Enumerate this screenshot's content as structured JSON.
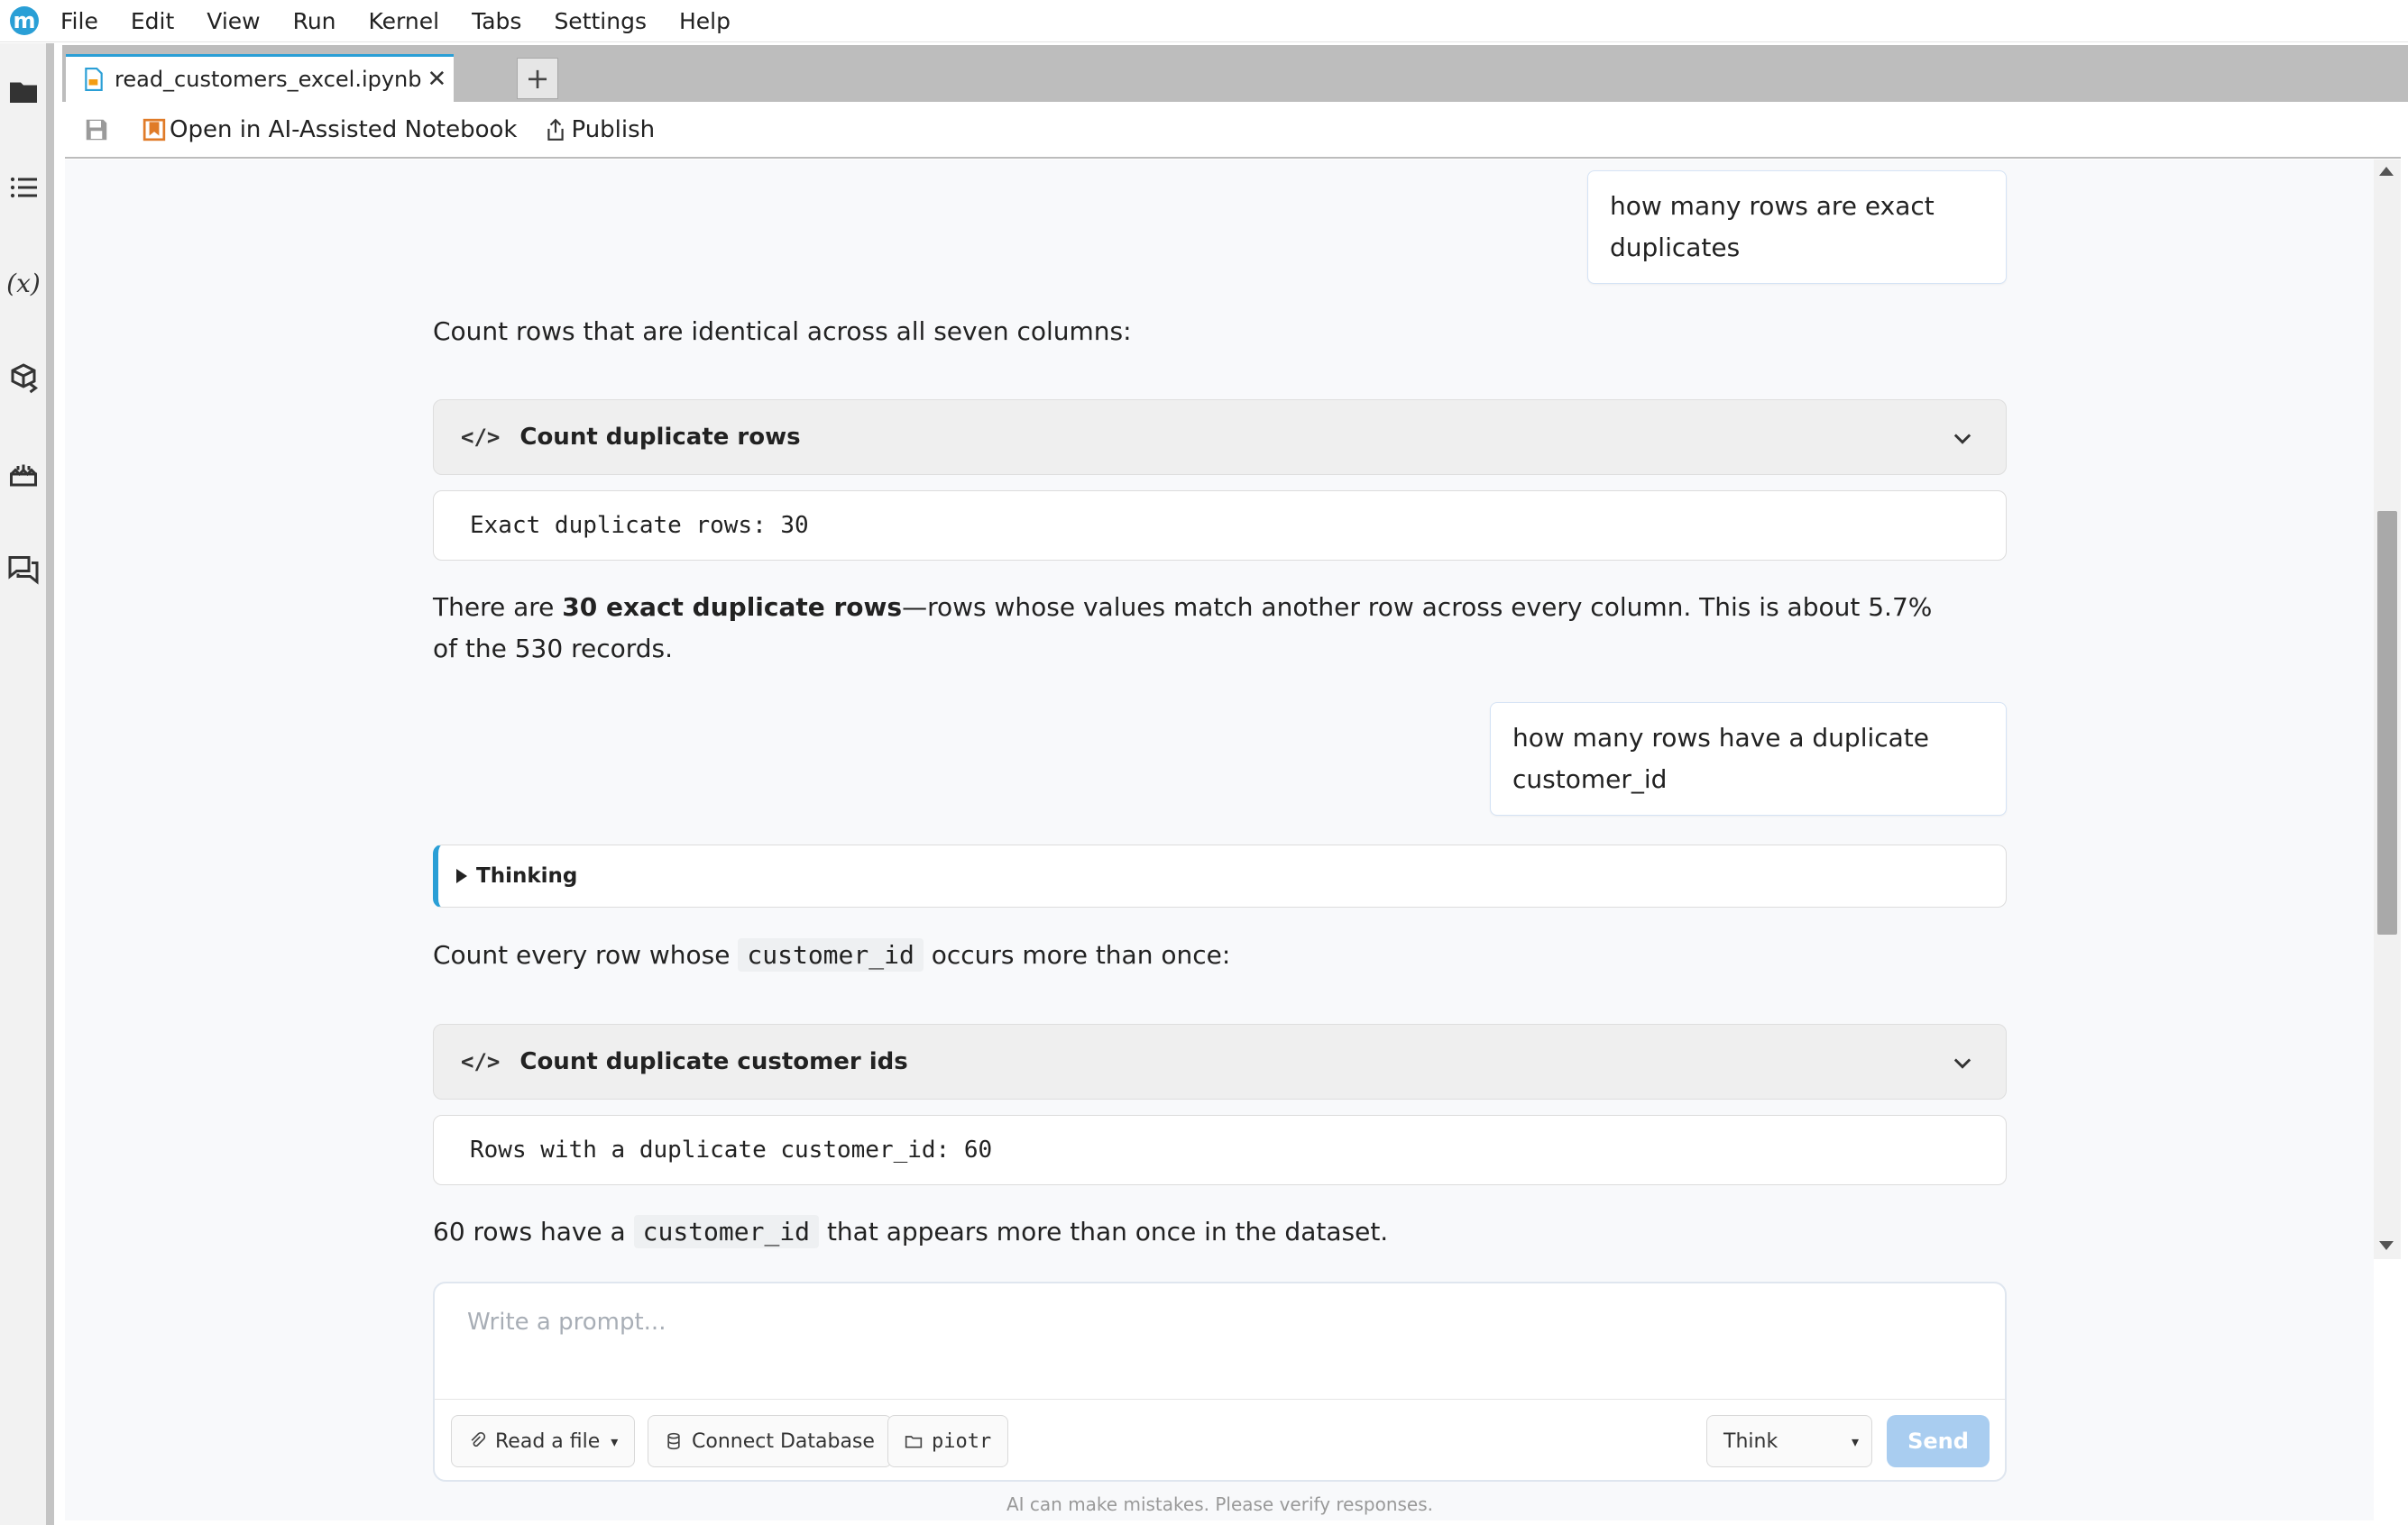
{
  "menubar": {
    "logo_letter": "m",
    "items": [
      "File",
      "Edit",
      "View",
      "Run",
      "Kernel",
      "Tabs",
      "Settings",
      "Help"
    ]
  },
  "sidebar": {
    "icons": [
      "folder-icon",
      "list-icon",
      "variable-icon",
      "package-icon",
      "cake-icon",
      "chat-icon"
    ],
    "variable_glyph": "(x)"
  },
  "tabs": {
    "active_label": "read_customers_excel.ipynb",
    "close_glyph": "✕",
    "add_glyph": "+"
  },
  "toolbar": {
    "open_ai_label": "Open in AI-Assisted Notebook",
    "publish_label": "Publish"
  },
  "conversation": {
    "user1": "how many rows are exact duplicates",
    "reply1_intro": "Count rows that are identical across all seven columns:",
    "code1_tag": "</>",
    "code1_title": "Count duplicate rows",
    "output1": "Exact duplicate rows: 30",
    "reply1_pre": "There are ",
    "reply1_bold": "30 exact duplicate rows",
    "reply1_post": "—rows whose values match another row across every column. This is about 5.7% of the 530 records.",
    "user2": "how many rows have a duplicate customer_id",
    "thinking_label": "Thinking",
    "reply2_intro_pre": "Count every row whose ",
    "reply2_intro_code": "customer_id",
    "reply2_intro_post": " occurs more than once:",
    "code2_tag": "</>",
    "code2_title": "Count duplicate customer ids",
    "output2": "Rows with a duplicate customer_id: 60",
    "reply2_pre": "60 rows have a ",
    "reply2_code": "customer_id",
    "reply2_post": " that appears more than once in the dataset."
  },
  "prompt": {
    "placeholder": "Write a prompt...",
    "read_file_label": "Read a file",
    "connect_db_label": "Connect Database",
    "folder_label": "piotr",
    "think_value": "Think",
    "send_label": "Send",
    "caret": "▾",
    "disclaimer": "AI can make mistakes. Please verify responses."
  },
  "colors": {
    "accent": "#2a9fd6",
    "send_disabled": "#a9cdf0"
  }
}
